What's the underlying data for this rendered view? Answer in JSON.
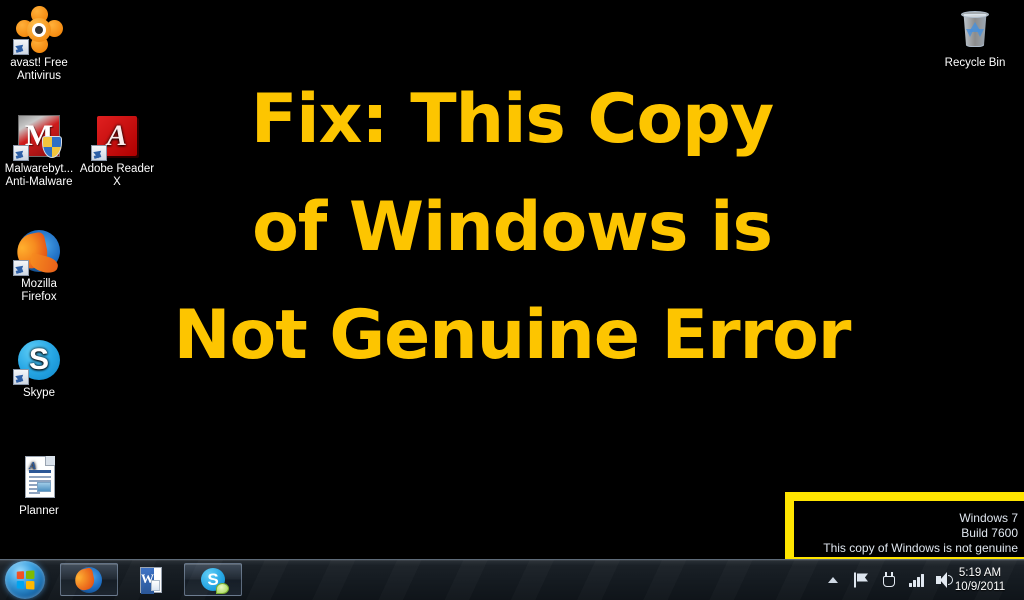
{
  "overlay": {
    "accent_color": "#FDC500",
    "highlight_color": "#FFE500",
    "lines": [
      "Fix: This Copy",
      "of Windows is",
      "Not Genuine Error"
    ]
  },
  "desktop": {
    "background_color": "#000000",
    "icons": [
      {
        "name": "avast-free-antivirus",
        "label_line1": "avast! Free",
        "label_line2": "Antivirus",
        "shortcut": true
      },
      {
        "name": "malwarebytes-anti-malware",
        "label_line1": "Malwarebyt...",
        "label_line2": "Anti-Malware",
        "shortcut": true
      },
      {
        "name": "adobe-reader-x",
        "label_line1": "Adobe Reader",
        "label_line2": "X",
        "shortcut": true
      },
      {
        "name": "mozilla-firefox",
        "label_line1": "Mozilla",
        "label_line2": "Firefox",
        "shortcut": true
      },
      {
        "name": "skype",
        "label_line1": "Skype",
        "label_line2": "",
        "shortcut": true
      },
      {
        "name": "planner",
        "label_line1": "Planner",
        "label_line2": "",
        "shortcut": false
      },
      {
        "name": "recycle-bin",
        "label_line1": "Recycle Bin",
        "label_line2": "",
        "shortcut": false
      }
    ],
    "adobe_glyph": "A",
    "malwarebytes_glyph": "M",
    "skype_glyph": "S",
    "planner_glyph": "A"
  },
  "watermark": {
    "line1": "Windows 7",
    "line2": "Build 7600",
    "line3": "This copy of Windows is not genuine"
  },
  "taskbar": {
    "start_button_label": "Start",
    "buttons": [
      {
        "name": "taskbar-firefox",
        "label": "Mozilla Firefox"
      },
      {
        "name": "taskbar-word",
        "label": "Microsoft Word",
        "glyph": "W"
      },
      {
        "name": "taskbar-skype",
        "label": "Skype",
        "glyph": "S"
      }
    ],
    "tray": [
      {
        "name": "show-hidden-icons",
        "label": "Show hidden icons"
      },
      {
        "name": "action-center",
        "label": "Action Center"
      },
      {
        "name": "power-icon",
        "label": "Power"
      },
      {
        "name": "network-icon",
        "label": "Network"
      },
      {
        "name": "volume-icon",
        "label": "Volume"
      }
    ],
    "clock": {
      "time": "5:19 AM",
      "date": "10/9/2011"
    }
  }
}
